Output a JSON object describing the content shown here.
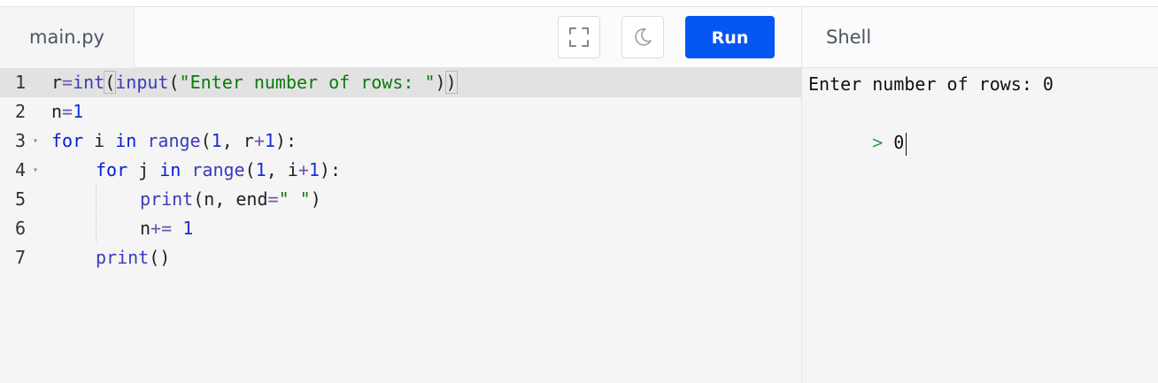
{
  "editor": {
    "file_tab": "main.py",
    "run_label": "Run",
    "fullscreen_icon": "fullscreen-icon",
    "theme_icon": "moon-icon",
    "lines": [
      {
        "number": "1",
        "tokens": [
          {
            "t": "r",
            "c": ""
          },
          {
            "t": "=",
            "c": "op"
          },
          {
            "t": "int",
            "c": "bi"
          },
          {
            "t": "(",
            "c": "bracket"
          },
          {
            "t": "input",
            "c": "bi"
          },
          {
            "t": "(",
            "c": ""
          },
          {
            "t": "\"Enter number of rows: \"",
            "c": "str"
          },
          {
            "t": ")",
            "c": ""
          },
          {
            "t": ")",
            "c": "bracket"
          }
        ]
      },
      {
        "number": "2",
        "tokens": [
          {
            "t": "n",
            "c": ""
          },
          {
            "t": "=",
            "c": "op"
          },
          {
            "t": "1",
            "c": "num"
          }
        ]
      },
      {
        "number": "3",
        "tokens": [
          {
            "t": "for",
            "c": "kw"
          },
          {
            "t": " i ",
            "c": ""
          },
          {
            "t": "in",
            "c": "kw"
          },
          {
            "t": " ",
            "c": ""
          },
          {
            "t": "range",
            "c": "bi"
          },
          {
            "t": "(",
            "c": ""
          },
          {
            "t": "1",
            "c": "num"
          },
          {
            "t": ", r",
            "c": ""
          },
          {
            "t": "+",
            "c": "op"
          },
          {
            "t": "1",
            "c": "num"
          },
          {
            "t": "):",
            "c": ""
          }
        ]
      },
      {
        "number": "4",
        "tokens": [
          {
            "t": "for",
            "c": "kw"
          },
          {
            "t": " j ",
            "c": ""
          },
          {
            "t": "in",
            "c": "kw"
          },
          {
            "t": " ",
            "c": ""
          },
          {
            "t": "range",
            "c": "bi"
          },
          {
            "t": "(",
            "c": ""
          },
          {
            "t": "1",
            "c": "num"
          },
          {
            "t": ", i",
            "c": ""
          },
          {
            "t": "+",
            "c": "op"
          },
          {
            "t": "1",
            "c": "num"
          },
          {
            "t": "):",
            "c": ""
          }
        ]
      },
      {
        "number": "5",
        "tokens": [
          {
            "t": "print",
            "c": "bi"
          },
          {
            "t": "(n, end",
            "c": ""
          },
          {
            "t": "=",
            "c": "op"
          },
          {
            "t": "\" \"",
            "c": "str"
          },
          {
            "t": ")",
            "c": ""
          }
        ]
      },
      {
        "number": "6",
        "tokens": [
          {
            "t": "n",
            "c": ""
          },
          {
            "t": "+=",
            "c": "op"
          },
          {
            "t": " ",
            "c": ""
          },
          {
            "t": "1",
            "c": "num"
          }
        ]
      },
      {
        "number": "7",
        "tokens": [
          {
            "t": "print",
            "c": "bi"
          },
          {
            "t": "()",
            "c": ""
          }
        ]
      }
    ]
  },
  "shell": {
    "title": "Shell",
    "output_line": "Enter number of rows: 0",
    "prompt_symbol": ">",
    "input_value": "0"
  },
  "colors": {
    "run_button": "#0556f3",
    "keyword": "#0a1cd4",
    "string": "#0b7a0b",
    "number": "#1a2fd6",
    "active_line": "#e2e2e2"
  }
}
